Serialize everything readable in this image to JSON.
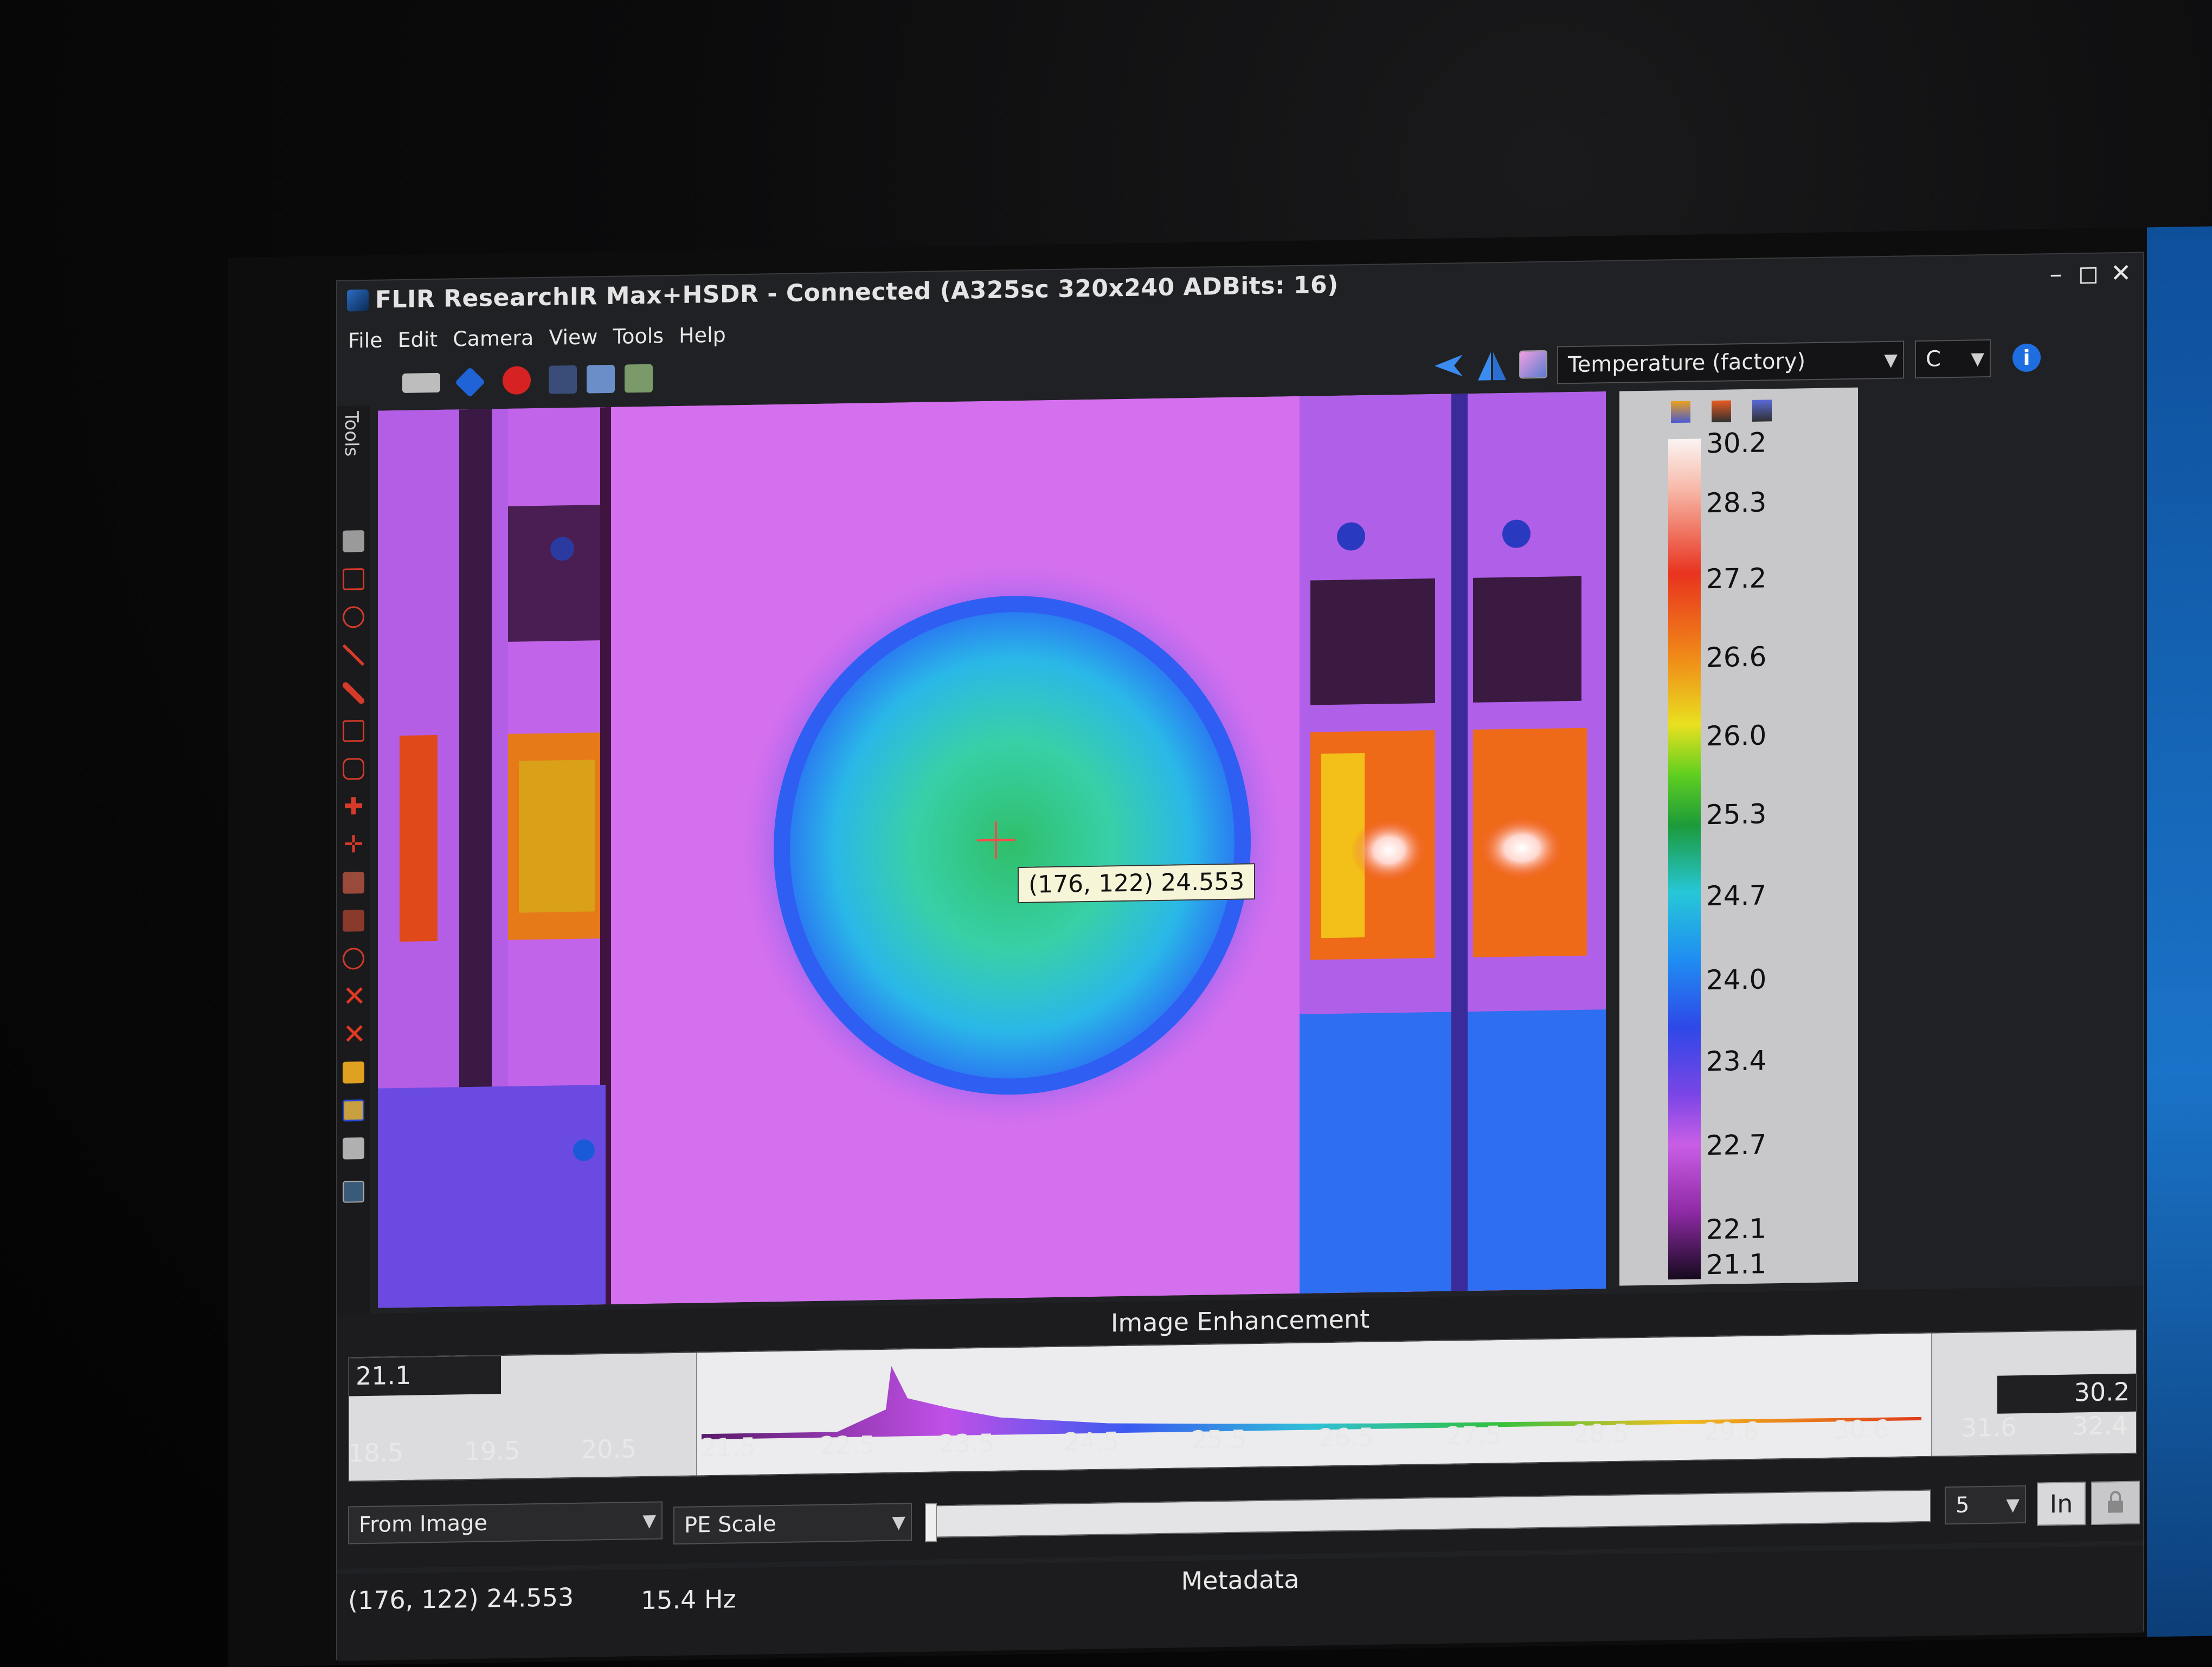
{
  "window": {
    "title": "FLIR ResearchIR Max+HSDR - Connected (A325sc 320x240 ADBits: 16)",
    "minimize": "–",
    "maximize": "◻",
    "close": "✕"
  },
  "menu": [
    "File",
    "Edit",
    "Camera",
    "View",
    "Tools",
    "Help"
  ],
  "toolbar": {
    "measurement_mode": "Temperature (factory)",
    "unit": "C",
    "info_icon": "i"
  },
  "tools_panel": {
    "label": "Tools"
  },
  "image": {
    "cursor_readout": "(176, 122) 24.553"
  },
  "color_scale": {
    "labels": [
      "30.2",
      "28.3",
      "27.2",
      "26.6",
      "26.0",
      "25.3",
      "24.7",
      "24.0",
      "23.4",
      "22.7",
      "22.1",
      "21.1"
    ]
  },
  "enhancement": {
    "title": "Image Enhancement",
    "min_value": "21.1",
    "max_value": "30.2",
    "ticks": [
      "18.5",
      "19.5",
      "20.5",
      "21.5",
      "22.5",
      "23.5",
      "24.5",
      "25.5",
      "26.5",
      "27.5",
      "28.5",
      "29.6",
      "30.6",
      "31.6",
      "32.4"
    ],
    "range_source": "From Image",
    "scale_mode": "PE Scale",
    "step_value": "5",
    "in_button": "In"
  },
  "metadata": {
    "title": "Metadata",
    "cursor_status": "(176, 122) 24.553",
    "frame_rate": "15.4 Hz"
  },
  "colors": {
    "scale_hot": "#fbf4f2",
    "scale_cold": "#150a1e",
    "panel_bg": "#1c1c1e"
  }
}
